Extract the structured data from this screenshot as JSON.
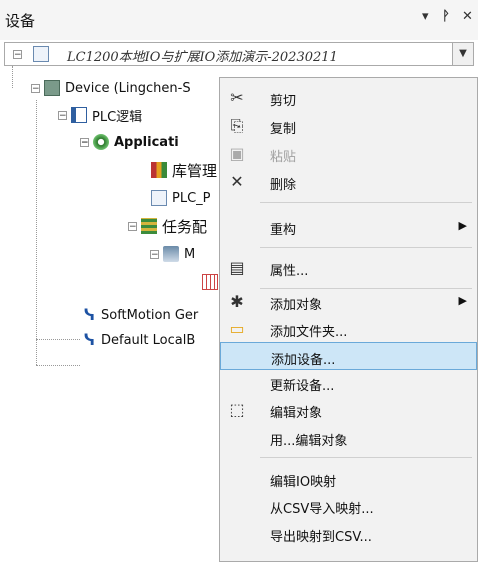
{
  "panel": {
    "title": "设备",
    "buttons": [
      "▾",
      "ᚹ",
      "✕"
    ]
  },
  "project": {
    "name": "LC1200本地IO与扩展IO添加演示-20230211"
  },
  "tree": {
    "device": "Device (Lingchen-S",
    "plc": "PLC逻辑",
    "application": "Applicati",
    "library": "库管理",
    "plc_prg": "PLC_P",
    "tasks": "任务配",
    "main_task": "M",
    "softmotion": "SoftMotion Ger",
    "localbus": "Default LocalB"
  },
  "context_menu": {
    "items": [
      {
        "label": "剪切",
        "icon": "cut-icon",
        "glyph": "✂",
        "enabled": true
      },
      {
        "label": "复制",
        "icon": "copy-icon",
        "glyph": "⎘",
        "enabled": true
      },
      {
        "label": "粘贴",
        "icon": "paste-icon",
        "glyph": "📋",
        "enabled": false
      },
      {
        "label": "删除",
        "icon": "delete-icon",
        "glyph": "✕",
        "enabled": true
      },
      {
        "label": "重构",
        "submenu": true,
        "enabled": true
      },
      {
        "label": "属性...",
        "icon": "properties-icon",
        "glyph": "▤",
        "enabled": true
      },
      {
        "label": "添加对象",
        "icon": "add-object-icon",
        "glyph": "✱",
        "submenu": true,
        "enabled": true
      },
      {
        "label": "添加文件夹...",
        "icon": "folder-icon",
        "glyph": "▭",
        "enabled": true
      },
      {
        "label": "添加设备...",
        "enabled": true,
        "highlighted": true
      },
      {
        "label": "更新设备...",
        "enabled": true
      },
      {
        "label": "编辑对象",
        "icon": "edit-object-icon",
        "glyph": "⬚",
        "enabled": true
      },
      {
        "label": "用...编辑对象",
        "enabled": true
      },
      {
        "label": "编辑IO映射",
        "enabled": true
      },
      {
        "label": "从CSV导入映射...",
        "enabled": true
      },
      {
        "label": "导出映射到CSV...",
        "enabled": true
      }
    ]
  }
}
